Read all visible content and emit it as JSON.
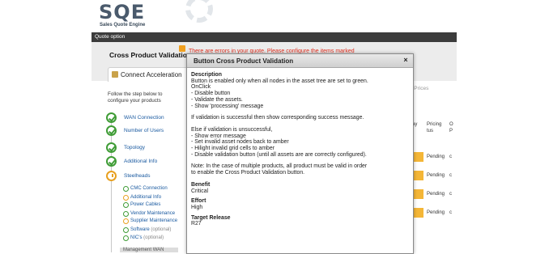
{
  "app": {
    "logo_text": "SQE",
    "logo_subtitle": "Sales Quote Engine",
    "topbar_title": "Quote option"
  },
  "product": {
    "title": "Cross Product Validation",
    "error_message": "There are errors in your quote. Please configure the items marked"
  },
  "tabs": [
    {
      "label": "Connect Acceleration"
    }
  ],
  "get_prices_label": "Get Prices",
  "instructions": "Follow the step below to configure your products",
  "steps": [
    {
      "label": "WAN Connection",
      "status": "complete"
    },
    {
      "label": "Number of Users",
      "status": "complete"
    },
    {
      "label": "Topology",
      "status": "complete"
    },
    {
      "label": "Additional Info",
      "status": "complete"
    },
    {
      "label": "Steelheads",
      "status": "warning"
    }
  ],
  "substeps": [
    {
      "label": "CMC Connection",
      "optional": "",
      "status": "complete"
    },
    {
      "label": "Additional Info",
      "optional": "",
      "status": "warning"
    },
    {
      "label": "Power Cables",
      "optional": "",
      "status": "complete"
    },
    {
      "label": "Vendor Maintenance",
      "optional": "",
      "status": "complete"
    },
    {
      "label": "Supplier Maintenance",
      "optional": "",
      "status": "warning"
    },
    {
      "label": "Software",
      "optional": "(optional)",
      "status": "complete"
    },
    {
      "label": "NIC's",
      "optional": "(optional)",
      "status": "complete"
    }
  ],
  "management_label": "Management WAN",
  "grid": {
    "headers": [
      "ay",
      "Pricing",
      "tus",
      "O",
      "P"
    ],
    "rows": [
      {
        "status": "Pending",
        "link": "c"
      },
      {
        "status": "Pending",
        "link": "c"
      },
      {
        "status": "Pending",
        "link": "c"
      },
      {
        "status": "Pending",
        "link": "c"
      }
    ]
  },
  "tooltip": {
    "title": "Button Cross Product Validation",
    "close": "×",
    "description_heading": "Description",
    "description_lines": [
      "Button is enabled only when all nodes in the asset tree are set to green.",
      "OnClick",
      "- Disable button",
      "- Validate the assets.",
      "- Show 'processing' message",
      "",
      "If validation is successful then show corresponding success message.",
      "",
      "Else if validation is unsuccessful,",
      "- Show error message",
      "- Set invalid asset nodes back to amber",
      "- Hilight invalid grid cells to amber",
      "- Disable validation button (until all assets are are correctly configured).",
      "",
      "Note: In the case of multiple products, all product must be valid in order",
      "to enable the Cross Product Validation button."
    ],
    "benefit_heading": "Benefit",
    "benefit": "Critical",
    "effort_heading": "Effort",
    "effort": "High",
    "release_heading": "Target Release",
    "release": "R27"
  }
}
